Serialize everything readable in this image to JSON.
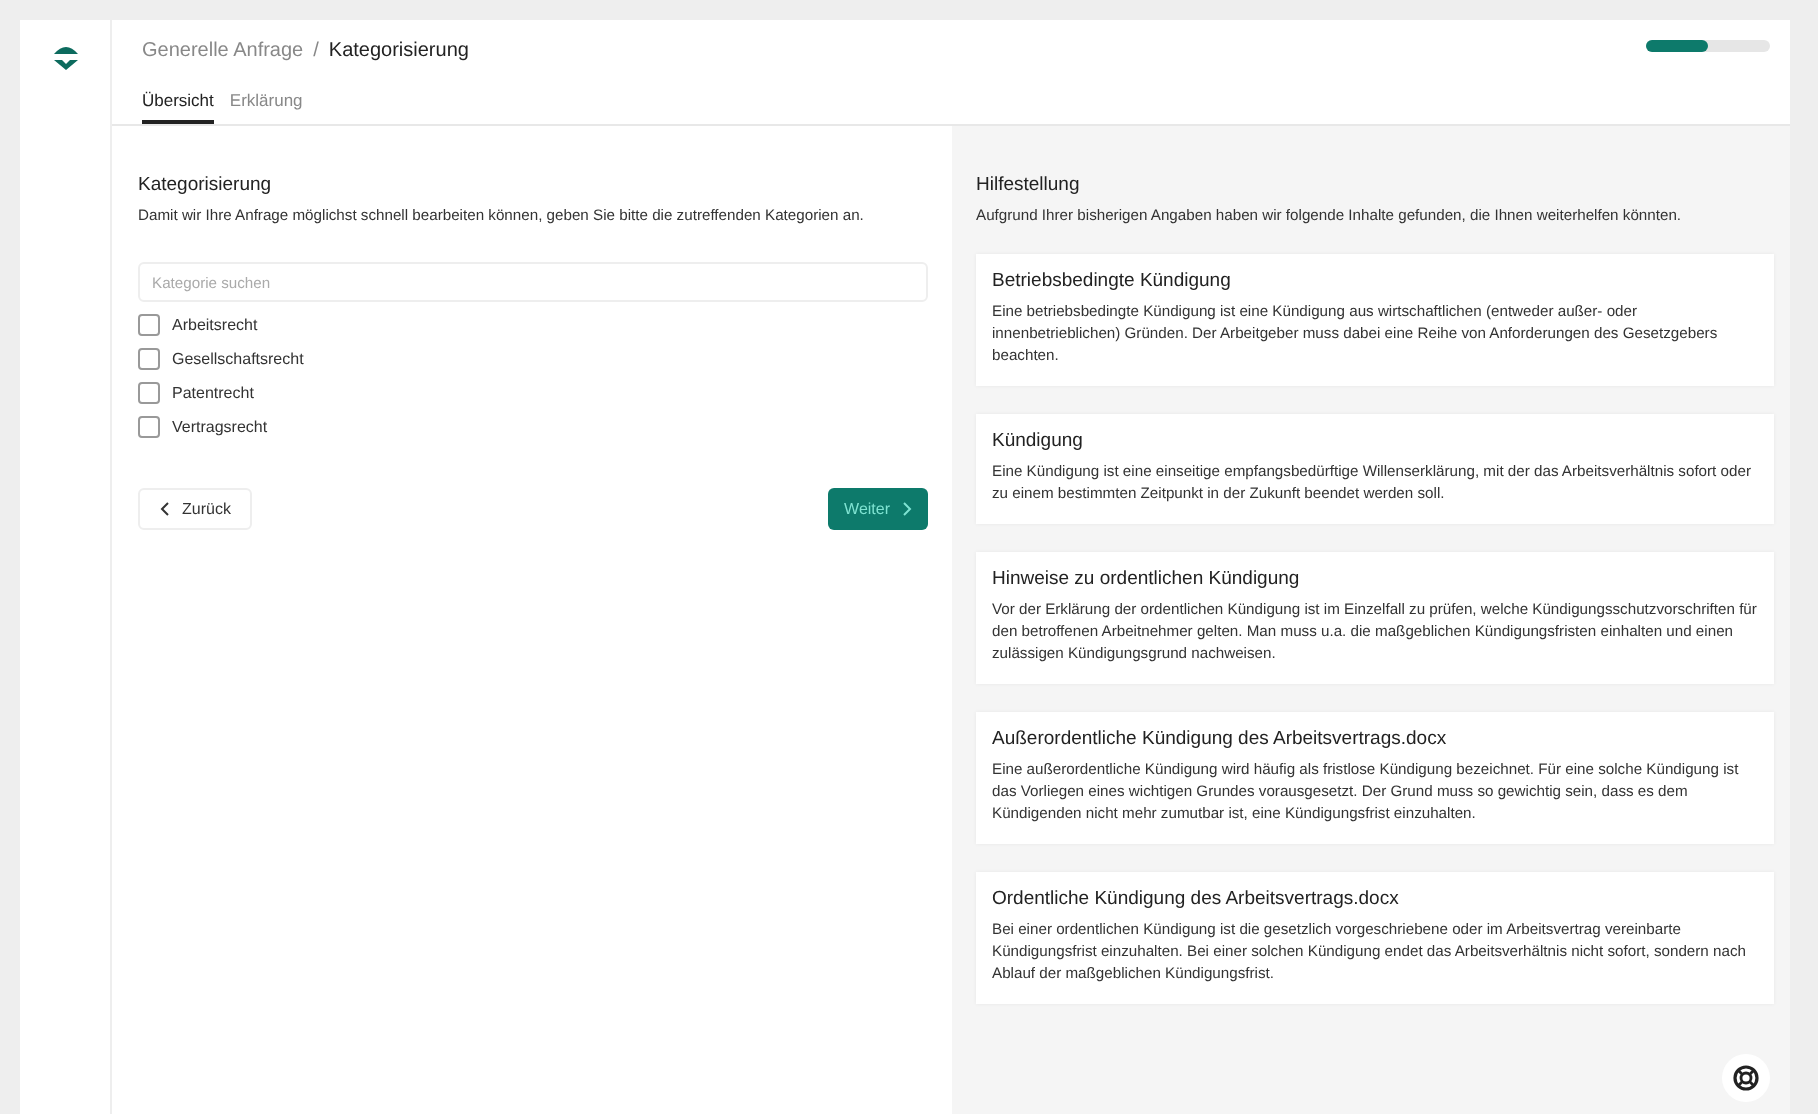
{
  "breadcrumb": {
    "parent": "Generelle Anfrage",
    "separator": "/",
    "current": "Kategorisierung"
  },
  "progress": {
    "level": 0.5
  },
  "tabs": [
    {
      "label": "Übersicht",
      "selected": true
    },
    {
      "label": "Erklärung",
      "selected": false
    }
  ],
  "form": {
    "title": "Kategorisierung",
    "description": "Damit wir Ihre Anfrage möglichst schnell bearbeiten können, geben Sie bitte die zutreffenden Kategorien an.",
    "search": {
      "placeholder": "Kategorie suchen"
    },
    "categories": [
      {
        "label": "Arbeitsrecht",
        "checked": false
      },
      {
        "label": "Gesellschaftsrecht",
        "checked": false
      },
      {
        "label": "Patentrecht",
        "checked": false
      },
      {
        "label": "Vertragsrecht",
        "checked": false
      }
    ],
    "back_button": "Zurück",
    "next_button": "Weiter"
  },
  "help": {
    "title": "Hilfestellung",
    "description": "Aufgrund Ihrer bisherigen Angaben haben wir folgende Inhalte gefunden, die Ihnen weiterhelfen könnten.",
    "cards": [
      {
        "title": "Betriebsbedingte Kündigung",
        "text": "Eine betriebsbedingte Kündigung ist eine Kündigung aus wirtschaftlichen (entweder außer- oder innenbetrieblichen) Gründen. Der Arbeitgeber muss dabei eine Reihe von Anforderungen des Gesetzgebers beachten."
      },
      {
        "title": "Kündigung",
        "text": "Eine Kündigung ist eine einseitige empfangsbedürftige Willenserklärung, mit der das Arbeitsverhältnis sofort oder zu einem bestimmten Zeitpunkt in der Zukunft beendet werden soll."
      },
      {
        "title": "Hinweise zu ordentlichen Kündigung",
        "text": "Vor der Erklärung der ordentlichen Kündigung ist im Einzelfall zu prüfen, welche Kündigungsschutzvorschriften für den betroffenen Arbeitnehmer gelten. Man muss u.a. die maßgeblichen Kündigungsfristen einhalten und einen zulässigen Kündigungsgrund nachweisen."
      },
      {
        "title": "Außerordentliche Kündigung des Arbeitsvertrags.docx",
        "text": "Eine außerordentliche Kündigung wird häufig als fristlose Kündigung bezeichnet. Für eine solche Kündigung ist das Vorliegen eines wichtigen Grundes vorausgesetzt. Der Grund muss so gewichtig sein, dass es dem Kündigenden nicht mehr zumutbar ist, eine Kündigungsfrist einzuhalten."
      },
      {
        "title": "Ordentliche Kündigung des Arbeitsvertrags.docx",
        "text": "Bei einer ordentlichen Kündigung ist die gesetzlich vorgeschriebene oder im Arbeitsvertrag vereinbarte Kündigungsfrist einzuhalten. Bei einer solchen Kündigung endet das Arbeitsverhältnis nicht sofort, sondern nach Ablauf der maßgeblichen Kündigungsfrist."
      }
    ]
  }
}
